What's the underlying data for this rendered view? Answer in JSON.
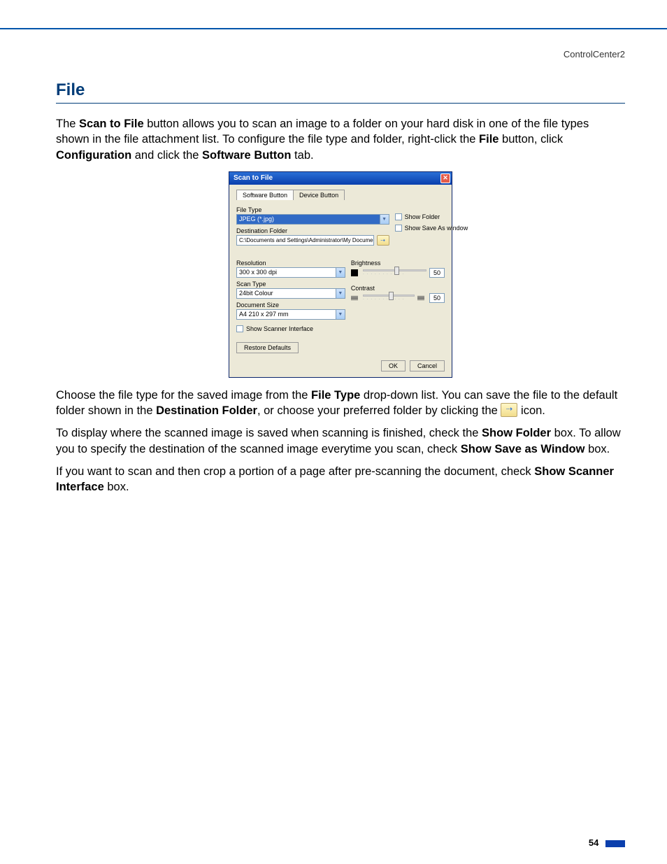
{
  "header": {
    "breadcrumb": "ControlCenter2"
  },
  "section": {
    "heading": "File"
  },
  "para1": {
    "t1": "The ",
    "b1": "Scan to File",
    "t2": " button allows you to scan an image to a folder on your hard disk in one of the file types shown in the file attachment list. To configure the file type and folder, right-click the ",
    "b2": "File",
    "t3": " button, click ",
    "b3": "Configuration",
    "t4": " and click the ",
    "b4": "Software Button",
    "t5": " tab."
  },
  "dialog": {
    "title": "Scan to File",
    "tabs": {
      "software": "Software Button",
      "device": "Device Button"
    },
    "labels": {
      "file_type": "File Type",
      "destination_folder": "Destination Folder",
      "resolution": "Resolution",
      "scan_type": "Scan Type",
      "document_size": "Document Size",
      "brightness": "Brightness",
      "contrast": "Contrast"
    },
    "values": {
      "file_type": "JPEG (*.jpg)",
      "destination_folder": "C:\\Documents and Settings\\Administrator\\My Docume",
      "resolution": "300 x 300 dpi",
      "scan_type": "24bit Colour",
      "document_size": "A4 210 x 297 mm",
      "brightness": "50",
      "contrast": "50"
    },
    "checkboxes": {
      "show_folder": "Show Folder",
      "show_save_as": "Show Save As window",
      "show_scanner_iface": "Show Scanner Interface"
    },
    "buttons": {
      "restore": "Restore Defaults",
      "ok": "OK",
      "cancel": "Cancel"
    }
  },
  "para2": {
    "t1": "Choose the file type for the saved image from the ",
    "b1": "File Type",
    "t2": " drop-down list. You can save the file to the default folder shown in the ",
    "b2": "Destination Folder",
    "t3": ", or choose your preferred folder by clicking the ",
    "t4": " icon."
  },
  "para3": {
    "t1": "To display where the scanned image is saved when scanning is finished, check the ",
    "b1": "Show Folder",
    "t2": " box. To allow you to specify the destination of the scanned image everytime you scan, check ",
    "b2": "Show Save as Window",
    "t3": " box."
  },
  "para4": {
    "t1": "If you want to scan and then crop a portion of a page after pre-scanning the document,  check ",
    "b1": "Show Scanner Interface",
    "t2": " box."
  },
  "footer": {
    "page_number": "54"
  }
}
